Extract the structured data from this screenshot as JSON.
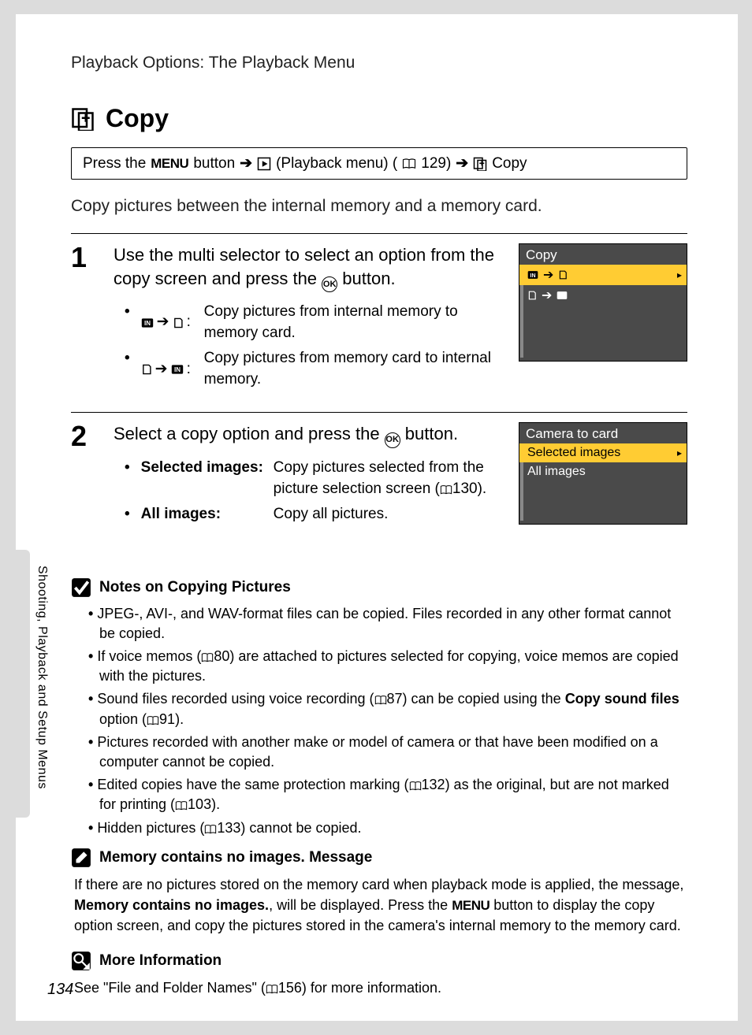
{
  "breadcrumb": "Playback Options: The Playback Menu",
  "title": "Copy",
  "path": {
    "prefix": "Press the ",
    "menu": "MENU",
    "mid1": " button ",
    "playback": " (Playback menu) (",
    "ref1": "129) ",
    "copy": " Copy"
  },
  "intro": "Copy pictures between the internal memory and a memory card.",
  "step1": {
    "num": "1",
    "head_a": "Use the multi selector to select an option from the copy screen and press the ",
    "head_b": " button.",
    "b1_desc": "Copy pictures from internal memory to memory card.",
    "b2_desc": "Copy pictures from memory card to internal memory."
  },
  "screen1": {
    "title": "Copy"
  },
  "step2": {
    "num": "2",
    "head_a": "Select a copy option and press the ",
    "head_b": " button.",
    "sel_label": "Selected images",
    "sel_desc_a": "Copy pictures selected from the picture selection screen (",
    "sel_desc_ref": "130).",
    "all_label": "All images",
    "all_desc": "Copy all pictures."
  },
  "screen2": {
    "title": "Camera to card",
    "item1": "Selected images",
    "item2": "All images"
  },
  "notes": {
    "title": "Notes on Copying Pictures",
    "n1": "JPEG-, AVI-, and WAV-format files can be copied. Files recorded in any other format cannot be copied.",
    "n2a": "If voice memos (",
    "n2ref": "80) are attached to pictures selected for copying, voice memos are copied with the pictures.",
    "n3a": "Sound files recorded using voice recording (",
    "n3ref1": "87) can be copied using the ",
    "n3bold": "Copy sound files",
    "n3b": " option (",
    "n3ref2": "91).",
    "n4": "Pictures recorded with another make or model of camera or that have been modified on a computer cannot be copied.",
    "n5a": "Edited copies have the same protection marking (",
    "n5ref1": "132) as the original, but are not marked for printing (",
    "n5ref2": "103).",
    "n6a": "Hidden pictures (",
    "n6ref": "133) cannot be copied."
  },
  "msg": {
    "title": "Memory contains no images. Message",
    "p1": "If there are no pictures stored on the memory card when playback mode is applied, the message, ",
    "bold": "Memory contains no images.",
    "p2": ", will be displayed. Press the ",
    "menu": "MENU",
    "p3": " button to display the copy option screen, and copy the pictures stored in the camera's internal memory to the memory card."
  },
  "more": {
    "title": "More Information",
    "p1": "See \"File and Folder Names\" (",
    "ref": "156) for more information."
  },
  "side": "Shooting, Playback and Setup Menus",
  "pagenum": "134"
}
